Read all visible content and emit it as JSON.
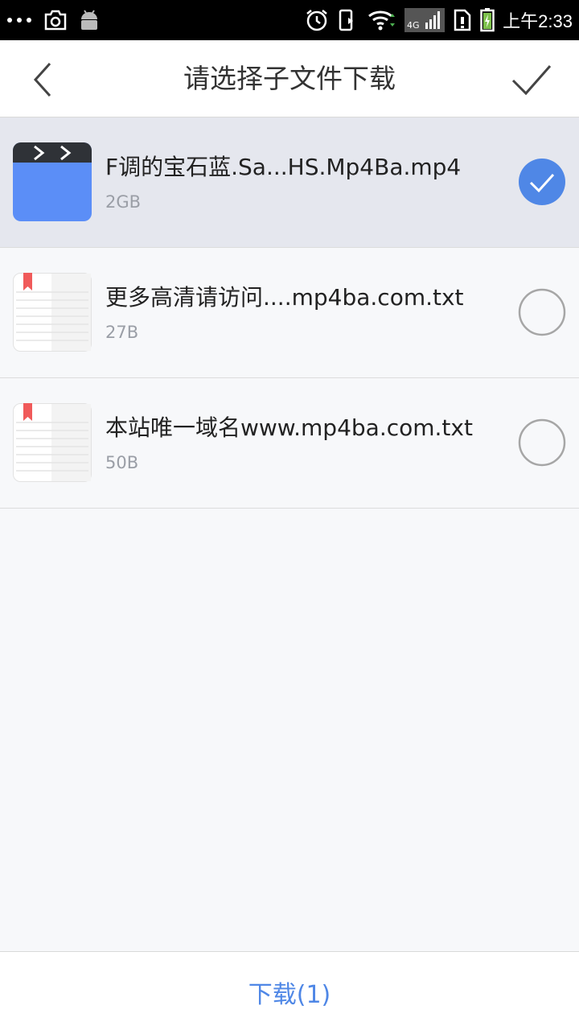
{
  "status_bar": {
    "time": "上午2:33",
    "network_type": "4G",
    "left_icons": [
      "more-dots-icon",
      "screenshot-camera-icon",
      "android-icon"
    ],
    "right_icons": [
      "alarm-icon",
      "vibrate-icon",
      "wifi-icon",
      "signal-4g-icon",
      "sim-alert-icon",
      "battery-charging-icon"
    ]
  },
  "header": {
    "title": "请选择子文件下载",
    "back_icon": "chevron-left-icon",
    "confirm_icon": "checkmark-icon"
  },
  "files": [
    {
      "name": "F调的宝石蓝.Sa...HS.Mp4Ba.mp4",
      "size": "2GB",
      "type": "video",
      "selected": true
    },
    {
      "name": "更多高清请访问....mp4ba.com.txt",
      "size": "27B",
      "type": "text",
      "selected": false
    },
    {
      "name": "本站唯一域名www.mp4ba.com.txt",
      "size": "50B",
      "type": "text",
      "selected": false
    }
  ],
  "bottom": {
    "download_label": "下载(1)"
  },
  "colors": {
    "accent": "#4f87e6",
    "video_icon_blue": "#5b8ef7",
    "selected_row": "#e5e7ee",
    "bookmark_red": "#f05a5a"
  }
}
